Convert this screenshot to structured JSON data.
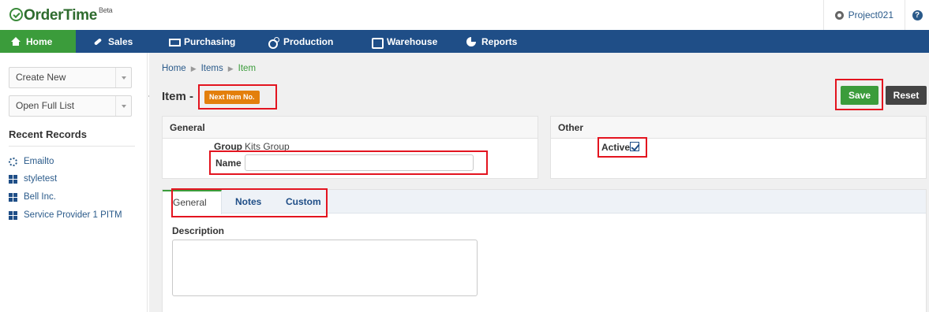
{
  "app": {
    "logo_text": "OrderTime",
    "logo_sup": "Beta"
  },
  "header": {
    "project_label": "Project021",
    "help_label": "?"
  },
  "nav": {
    "items": [
      {
        "label": "Home",
        "icon": "home-icon"
      },
      {
        "label": "Sales",
        "icon": "sales-icon"
      },
      {
        "label": "Purchasing",
        "icon": "cart-icon"
      },
      {
        "label": "Production",
        "icon": "cogs-icon"
      },
      {
        "label": "Warehouse",
        "icon": "box-icon"
      },
      {
        "label": "Reports",
        "icon": "pie-chart-icon"
      }
    ]
  },
  "sidebar": {
    "create_new": "Create New",
    "open_full_list": "Open Full List",
    "recent_title": "Recent Records",
    "recent": [
      {
        "label": "Emailto",
        "icon": "spinner-icon"
      },
      {
        "label": "styletest",
        "icon": "grid-icon"
      },
      {
        "label": "Bell Inc.",
        "icon": "grid-icon"
      },
      {
        "label": "Service Provider 1 PITM",
        "icon": "grid-icon"
      }
    ]
  },
  "breadcrumb": {
    "home": "Home",
    "items": "Items",
    "current": "Item"
  },
  "page": {
    "title": "Item -",
    "next_item_label": "Next Item No."
  },
  "actions": {
    "save": "Save",
    "reset": "Reset"
  },
  "general_panel": {
    "title": "General",
    "group_label": "Group",
    "group_value": "Kits Group",
    "name_label": "Name",
    "name_value": ""
  },
  "other_panel": {
    "title": "Other",
    "active_label": "Active",
    "active_checked": true
  },
  "tabs": {
    "general": "General",
    "notes": "Notes",
    "custom": "Custom"
  },
  "description": {
    "label": "Description",
    "value": ""
  },
  "colors": {
    "nav_bg": "#1f4e87",
    "accent_green": "#3b9c3b",
    "accent_orange": "#e37f0c",
    "highlight_red": "#e3141f"
  }
}
